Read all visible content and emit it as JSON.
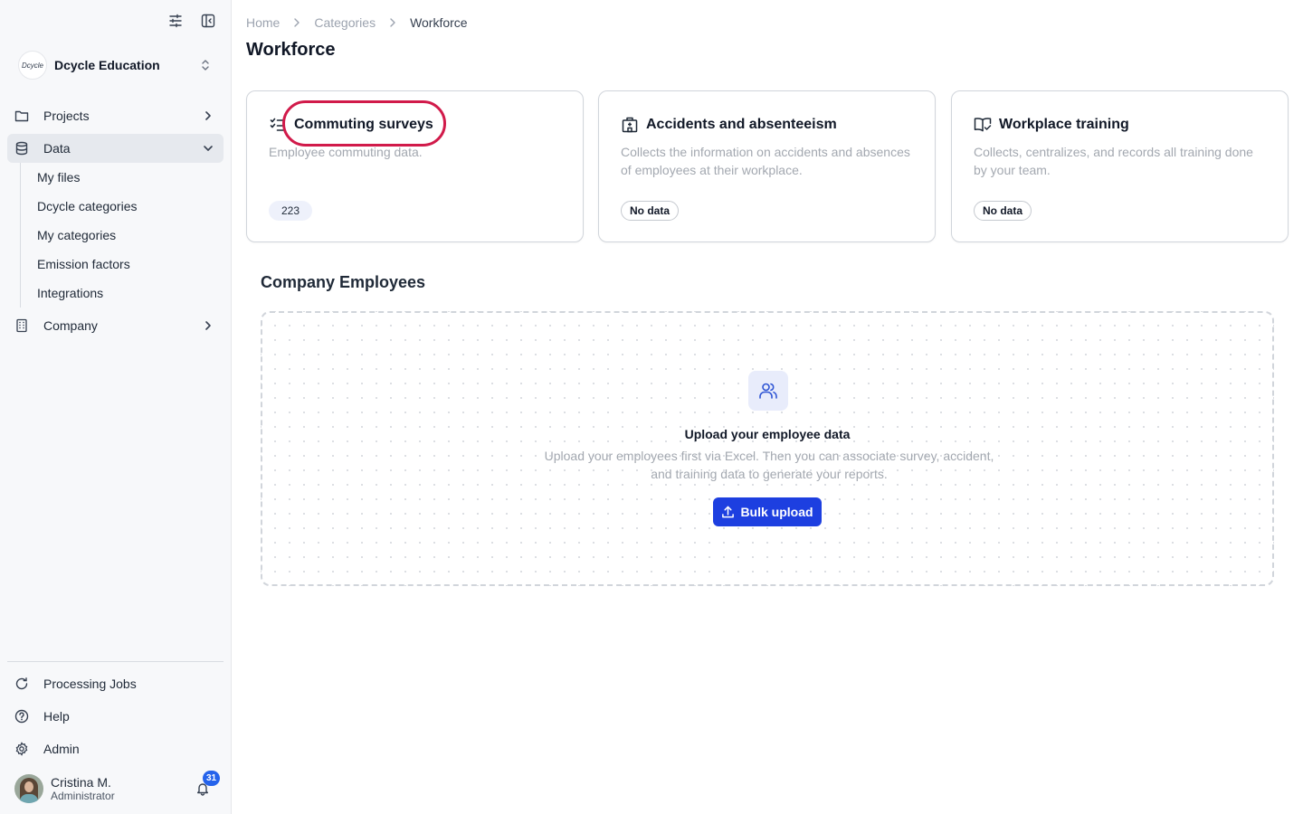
{
  "sidebar": {
    "org_name": "Dcycle Education",
    "org_logo_text": "Dcycle",
    "nav": {
      "projects": "Projects",
      "data": "Data",
      "company": "Company"
    },
    "data_sub": [
      "My files",
      "Dcycle categories",
      "My categories",
      "Emission factors",
      "Integrations"
    ],
    "bottom": {
      "processing_jobs": "Processing Jobs",
      "help": "Help",
      "admin": "Admin"
    },
    "user": {
      "name": "Cristina M.",
      "role": "Administrator",
      "notifications": "31"
    }
  },
  "breadcrumb": [
    "Home",
    "Categories",
    "Workforce"
  ],
  "page_title": "Workforce",
  "cards": [
    {
      "title": "Commuting surveys",
      "desc": "Employee commuting data.",
      "tag": "223",
      "icon": "checklist-icon"
    },
    {
      "title": "Accidents and absenteeism",
      "desc": "Collects the information on accidents and absences of employees at their workplace.",
      "tag": "No data",
      "icon": "hospital-icon"
    },
    {
      "title": "Workplace training",
      "desc": "Collects, centralizes, and records all training done by your team.",
      "tag": "No data",
      "icon": "book-check-icon"
    }
  ],
  "employees": {
    "section_title": "Company Employees",
    "empty_title": "Upload your employee data",
    "empty_desc": "Upload your employees first via Excel. Then you can associate survey, accident, and training data to generate your reports.",
    "button": "Bulk upload"
  },
  "colors": {
    "accent": "#1d3fe0",
    "highlight": "#d11a4a",
    "sidebar_bg": "#f7f8fa"
  }
}
